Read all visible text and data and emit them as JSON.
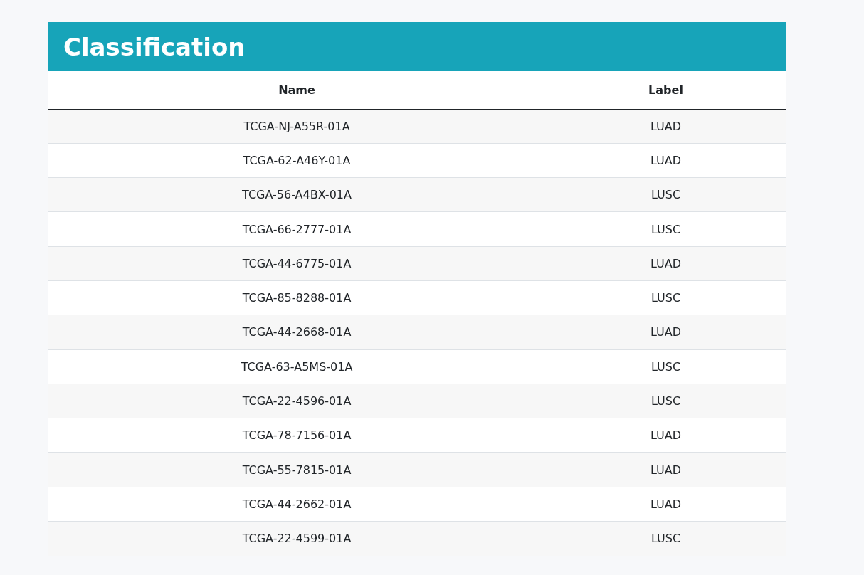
{
  "section": {
    "title": "Classification"
  },
  "table": {
    "columns": [
      "Name",
      "Label"
    ],
    "rows": [
      [
        "TCGA-NJ-A55R-01A",
        "LUAD"
      ],
      [
        "TCGA-62-A46Y-01A",
        "LUAD"
      ],
      [
        "TCGA-56-A4BX-01A",
        "LUSC"
      ],
      [
        "TCGA-66-2777-01A",
        "LUSC"
      ],
      [
        "TCGA-44-6775-01A",
        "LUAD"
      ],
      [
        "TCGA-85-8288-01A",
        "LUSC"
      ],
      [
        "TCGA-44-2668-01A",
        "LUAD"
      ],
      [
        "TCGA-63-A5MS-01A",
        "LUSC"
      ],
      [
        "TCGA-22-4596-01A",
        "LUSC"
      ],
      [
        "TCGA-78-7156-01A",
        "LUAD"
      ],
      [
        "TCGA-55-7815-01A",
        "LUAD"
      ],
      [
        "TCGA-44-2662-01A",
        "LUAD"
      ],
      [
        "TCGA-22-4599-01A",
        "LUSC"
      ]
    ]
  }
}
